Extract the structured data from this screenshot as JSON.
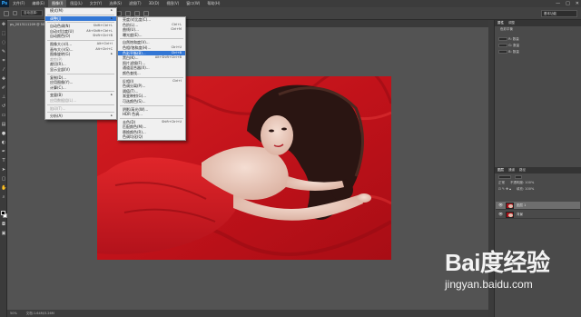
{
  "app": {
    "logo": "Ps"
  },
  "menubar": {
    "items": [
      {
        "label": "文件(F)"
      },
      {
        "label": "编辑(E)"
      },
      {
        "label": "图像(I)"
      },
      {
        "label": "图层(L)"
      },
      {
        "label": "文字(Y)"
      },
      {
        "label": "选择(S)"
      },
      {
        "label": "滤镜(T)"
      },
      {
        "label": "3D(D)"
      },
      {
        "label": "视图(V)"
      },
      {
        "label": "窗口(W)"
      },
      {
        "label": "帮助(H)"
      }
    ],
    "window_controls": [
      "—",
      "□",
      "✕"
    ]
  },
  "options_bar": {
    "auto_select_label": "自动选择：",
    "right_dropdown": "基本功能"
  },
  "document": {
    "tab_label": "ps_2013111209 @ 50%",
    "zoom": "50%",
    "doc_size": "文档:1.64M/3.26M"
  },
  "image_menu": {
    "items": [
      {
        "label": "模式(M)",
        "shortcut": "",
        "submenu": true,
        "disabled": false
      },
      {
        "sep": true
      },
      {
        "label": "调整(J)",
        "shortcut": "",
        "submenu": true,
        "highlight": true
      },
      {
        "sep": true
      },
      {
        "label": "自动色调(N)",
        "shortcut": "Shift+Ctrl+L"
      },
      {
        "label": "自动对比度(U)",
        "shortcut": "Alt+Shift+Ctrl+L"
      },
      {
        "label": "自动颜色(O)",
        "shortcut": "Shift+Ctrl+B"
      },
      {
        "sep": true
      },
      {
        "label": "图像大小(I)...",
        "shortcut": "Alt+Ctrl+I"
      },
      {
        "label": "画布大小(S)...",
        "shortcut": "Alt+Ctrl+C"
      },
      {
        "label": "图像旋转(G)",
        "shortcut": "",
        "submenu": true
      },
      {
        "label": "裁剪(P)",
        "shortcut": "",
        "disabled": true
      },
      {
        "label": "裁切(R)...",
        "shortcut": ""
      },
      {
        "label": "显示全部(V)",
        "shortcut": ""
      },
      {
        "sep": true
      },
      {
        "label": "复制(D)...",
        "shortcut": ""
      },
      {
        "label": "应用图像(Y)...",
        "shortcut": ""
      },
      {
        "label": "计算(C)...",
        "shortcut": ""
      },
      {
        "sep": true
      },
      {
        "label": "变量(B)",
        "shortcut": "",
        "submenu": true
      },
      {
        "label": "应用数据组(L)...",
        "shortcut": "",
        "disabled": true
      },
      {
        "sep": true
      },
      {
        "label": "陷印(T)...",
        "shortcut": "",
        "disabled": true
      },
      {
        "sep": true
      },
      {
        "label": "分析(A)",
        "shortcut": "",
        "submenu": true
      }
    ]
  },
  "adjust_menu": {
    "items": [
      {
        "label": "亮度/对比度(C)...",
        "shortcut": ""
      },
      {
        "label": "色阶(L)...",
        "shortcut": "Ctrl+L"
      },
      {
        "label": "曲线(U)...",
        "shortcut": "Ctrl+M"
      },
      {
        "label": "曝光度(E)...",
        "shortcut": ""
      },
      {
        "sep": true
      },
      {
        "label": "自然饱和度(V)...",
        "shortcut": ""
      },
      {
        "label": "色相/饱和度(H)...",
        "shortcut": "Ctrl+U"
      },
      {
        "label": "色彩平衡(B)...",
        "shortcut": "Ctrl+B",
        "highlight": true
      },
      {
        "label": "黑白(K)...",
        "shortcut": "Alt+Shift+Ctrl+B"
      },
      {
        "label": "照片滤镜(F)...",
        "shortcut": ""
      },
      {
        "label": "通道混合器(X)...",
        "shortcut": ""
      },
      {
        "label": "颜色查找...",
        "shortcut": ""
      },
      {
        "sep": true
      },
      {
        "label": "反相(I)",
        "shortcut": "Ctrl+I"
      },
      {
        "label": "色调分离(P)...",
        "shortcut": ""
      },
      {
        "label": "阈值(T)...",
        "shortcut": ""
      },
      {
        "label": "渐变映射(G)...",
        "shortcut": ""
      },
      {
        "label": "可选颜色(S)...",
        "shortcut": ""
      },
      {
        "sep": true
      },
      {
        "label": "阴影/高光(W)...",
        "shortcut": ""
      },
      {
        "label": "HDR 色调...",
        "shortcut": ""
      },
      {
        "sep": true
      },
      {
        "label": "去色(D)",
        "shortcut": "Shift+Ctrl+U"
      },
      {
        "label": "匹配颜色(M)...",
        "shortcut": ""
      },
      {
        "label": "替换颜色(R)...",
        "shortcut": ""
      },
      {
        "label": "色调均化(Q)",
        "shortcut": ""
      }
    ]
  },
  "right_panels": {
    "properties_tabs": [
      "属性",
      "调整"
    ],
    "properties_rows": [
      "R: 数量",
      "G: 数量",
      "B: 数量"
    ],
    "layers_title": "图层",
    "layers_tabs": [
      "图层",
      "通道",
      "路径"
    ],
    "blend_mode": "正常",
    "opacity_label": "不透明度: 100%",
    "fill_label": "填充: 100%",
    "props_title_text": "色彩平衡",
    "layers": [
      {
        "name": "图层 1",
        "selected": true
      },
      {
        "name": "背景",
        "selected": false
      }
    ]
  },
  "watermark": {
    "logo_text": "Bai度经验",
    "url": "jingyan.baidu.com"
  }
}
